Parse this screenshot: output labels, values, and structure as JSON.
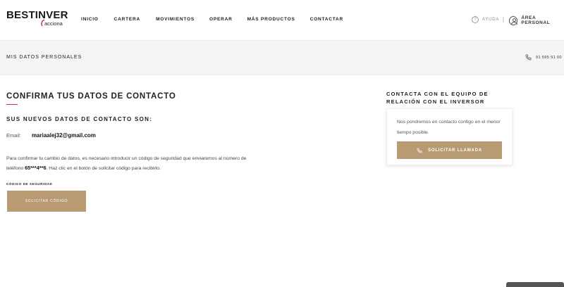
{
  "brand": {
    "name": "BESTINVER",
    "sub": "acciona"
  },
  "nav": [
    {
      "label": "INICIO"
    },
    {
      "label": "CARTERA"
    },
    {
      "label": "MOVIMIENTOS"
    },
    {
      "label": "OPERAR"
    },
    {
      "label": "MÁS PRODUCTOS"
    },
    {
      "label": "CONTACTAR"
    }
  ],
  "header_right": {
    "help_label": "AYUDA",
    "separator": "|",
    "area_label": "ÁREA PERSONAL"
  },
  "subbar": {
    "title": "MIS DATOS PERSONALES",
    "phone": "91 595 91 00"
  },
  "main": {
    "title": "CONFIRMA TUS DATOS DE CONTACTO",
    "new_data_title": "SUS NUEVOS DATOS DE CONTACTO SON:",
    "email_label": "Email:",
    "email_value": "mariaalej32@gmail.com",
    "info_before": "Para confirmar tu cambio de datos, es necesario introducir un código de seguridad que enviaremos al número de teléfono ",
    "info_phone": "65***4**6",
    "info_after": ". Haz clic en el botón de solicitar código para recibirlo.",
    "code_label": "CÓDIGO DE SEGURIDAD",
    "request_code_button": "SOLICITAR CÓDIGO"
  },
  "contact_panel": {
    "title": "CONTACTA CON EL EQUIPO DE RELACIÓN CON EL INVERSOR",
    "text": "Nos pondremos en contacto contigo en el menor tiempo posible.",
    "call_button": "SOLICITAR LLAMADA"
  },
  "colors": {
    "accent": "#b89b72",
    "rule": "#c0392b",
    "subbar_bg": "#f5f5f5"
  }
}
